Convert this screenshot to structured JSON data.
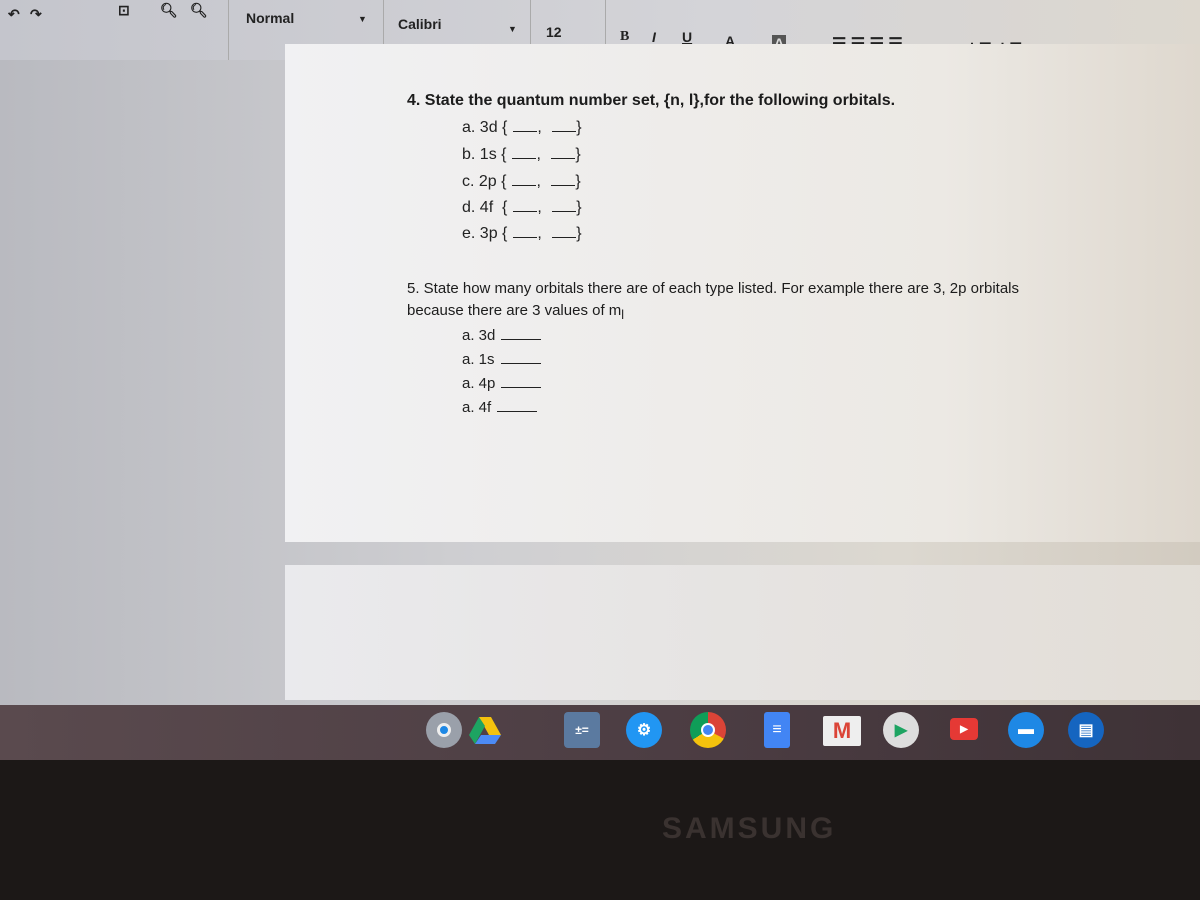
{
  "toolbar": {
    "undo_icon": "undo-icon",
    "redo_icon": "redo-icon",
    "style": "Normal",
    "font": "Calibri",
    "size": "12",
    "bold": "B",
    "italic": "I",
    "underline": "U",
    "text_color": "A",
    "highlight": "A"
  },
  "question4": {
    "title": "4. State the quantum number set, {n, l},for the following orbitals.",
    "items": [
      {
        "label": "a. 3d"
      },
      {
        "label": "b. 1s"
      },
      {
        "label": "c. 2p"
      },
      {
        "label": "d. 4f"
      },
      {
        "label": "e. 3p"
      }
    ]
  },
  "question5": {
    "line1": "5. State how many orbitals there are of each type listed.  For example there are 3, 2p orbitals",
    "line2": "because there are 3 values of m",
    "subscript": "l",
    "items": [
      {
        "label": "a. 3d"
      },
      {
        "label": "a. 1s"
      },
      {
        "label": "a. 4p"
      },
      {
        "label": "a. 4f"
      }
    ]
  },
  "shelf": {
    "apps": [
      "camera-icon",
      "drive-icon",
      "calculator-icon",
      "settings-icon",
      "chrome-icon",
      "docs-icon",
      "gmail-icon",
      "play-store-icon",
      "youtube-icon",
      "files-icon",
      "extra-app-icon"
    ]
  },
  "brand": "SAMSUNG"
}
